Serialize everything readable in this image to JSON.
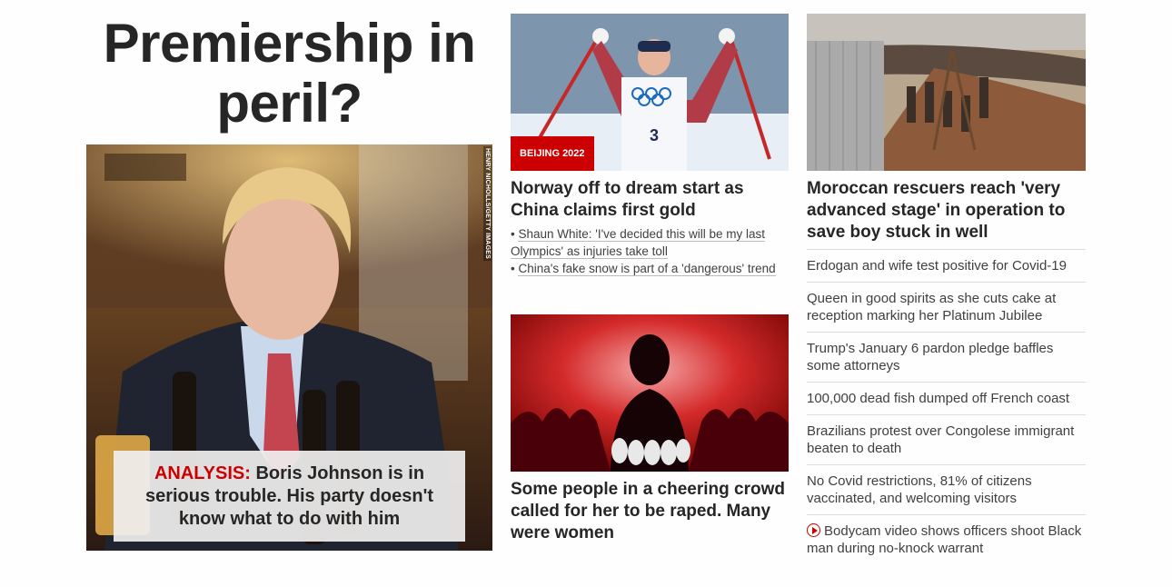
{
  "lead": {
    "title": "Premiership in peril?",
    "credit": "HENRY NICHOLLS/GETTY IMAGES",
    "kicker": "ANALYSIS:",
    "caption": " Boris Johnson is in serious trouble. His party doesn't know what to do with him"
  },
  "middle": {
    "badge": "BEIJING 2022",
    "norway_headline": "Norway off to dream start as China claims first gold",
    "sub_items": [
      "Shaun White: 'I've decided this will be my last Olympics' as injuries take toll",
      "China's fake snow is part of a 'dangerous' trend"
    ],
    "bullet": "• ",
    "second_headline": "Some people in a cheering crowd called for her to be raped. Many were women"
  },
  "right": {
    "main_headline": "Moroccan rescuers reach 'very advanced stage' in operation to save boy stuck in well",
    "items": [
      "Erdogan and wife test positive for Covid-19",
      "Queen in good spirits as she cuts cake at reception marking her Platinum Jubilee",
      "Trump's January 6 pardon pledge baffles some attorneys",
      "100,000 dead fish dumped off French coast",
      "Brazilians protest over Congolese immigrant beaten to death",
      "No Covid restrictions, 81% of citizens vaccinated, and welcoming visitors",
      "Bodycam video shows officers shoot Black man during no-knock warrant"
    ],
    "video_icon": "play-circle-icon"
  },
  "colors": {
    "accent": "#cc0000",
    "text": "#262626"
  }
}
